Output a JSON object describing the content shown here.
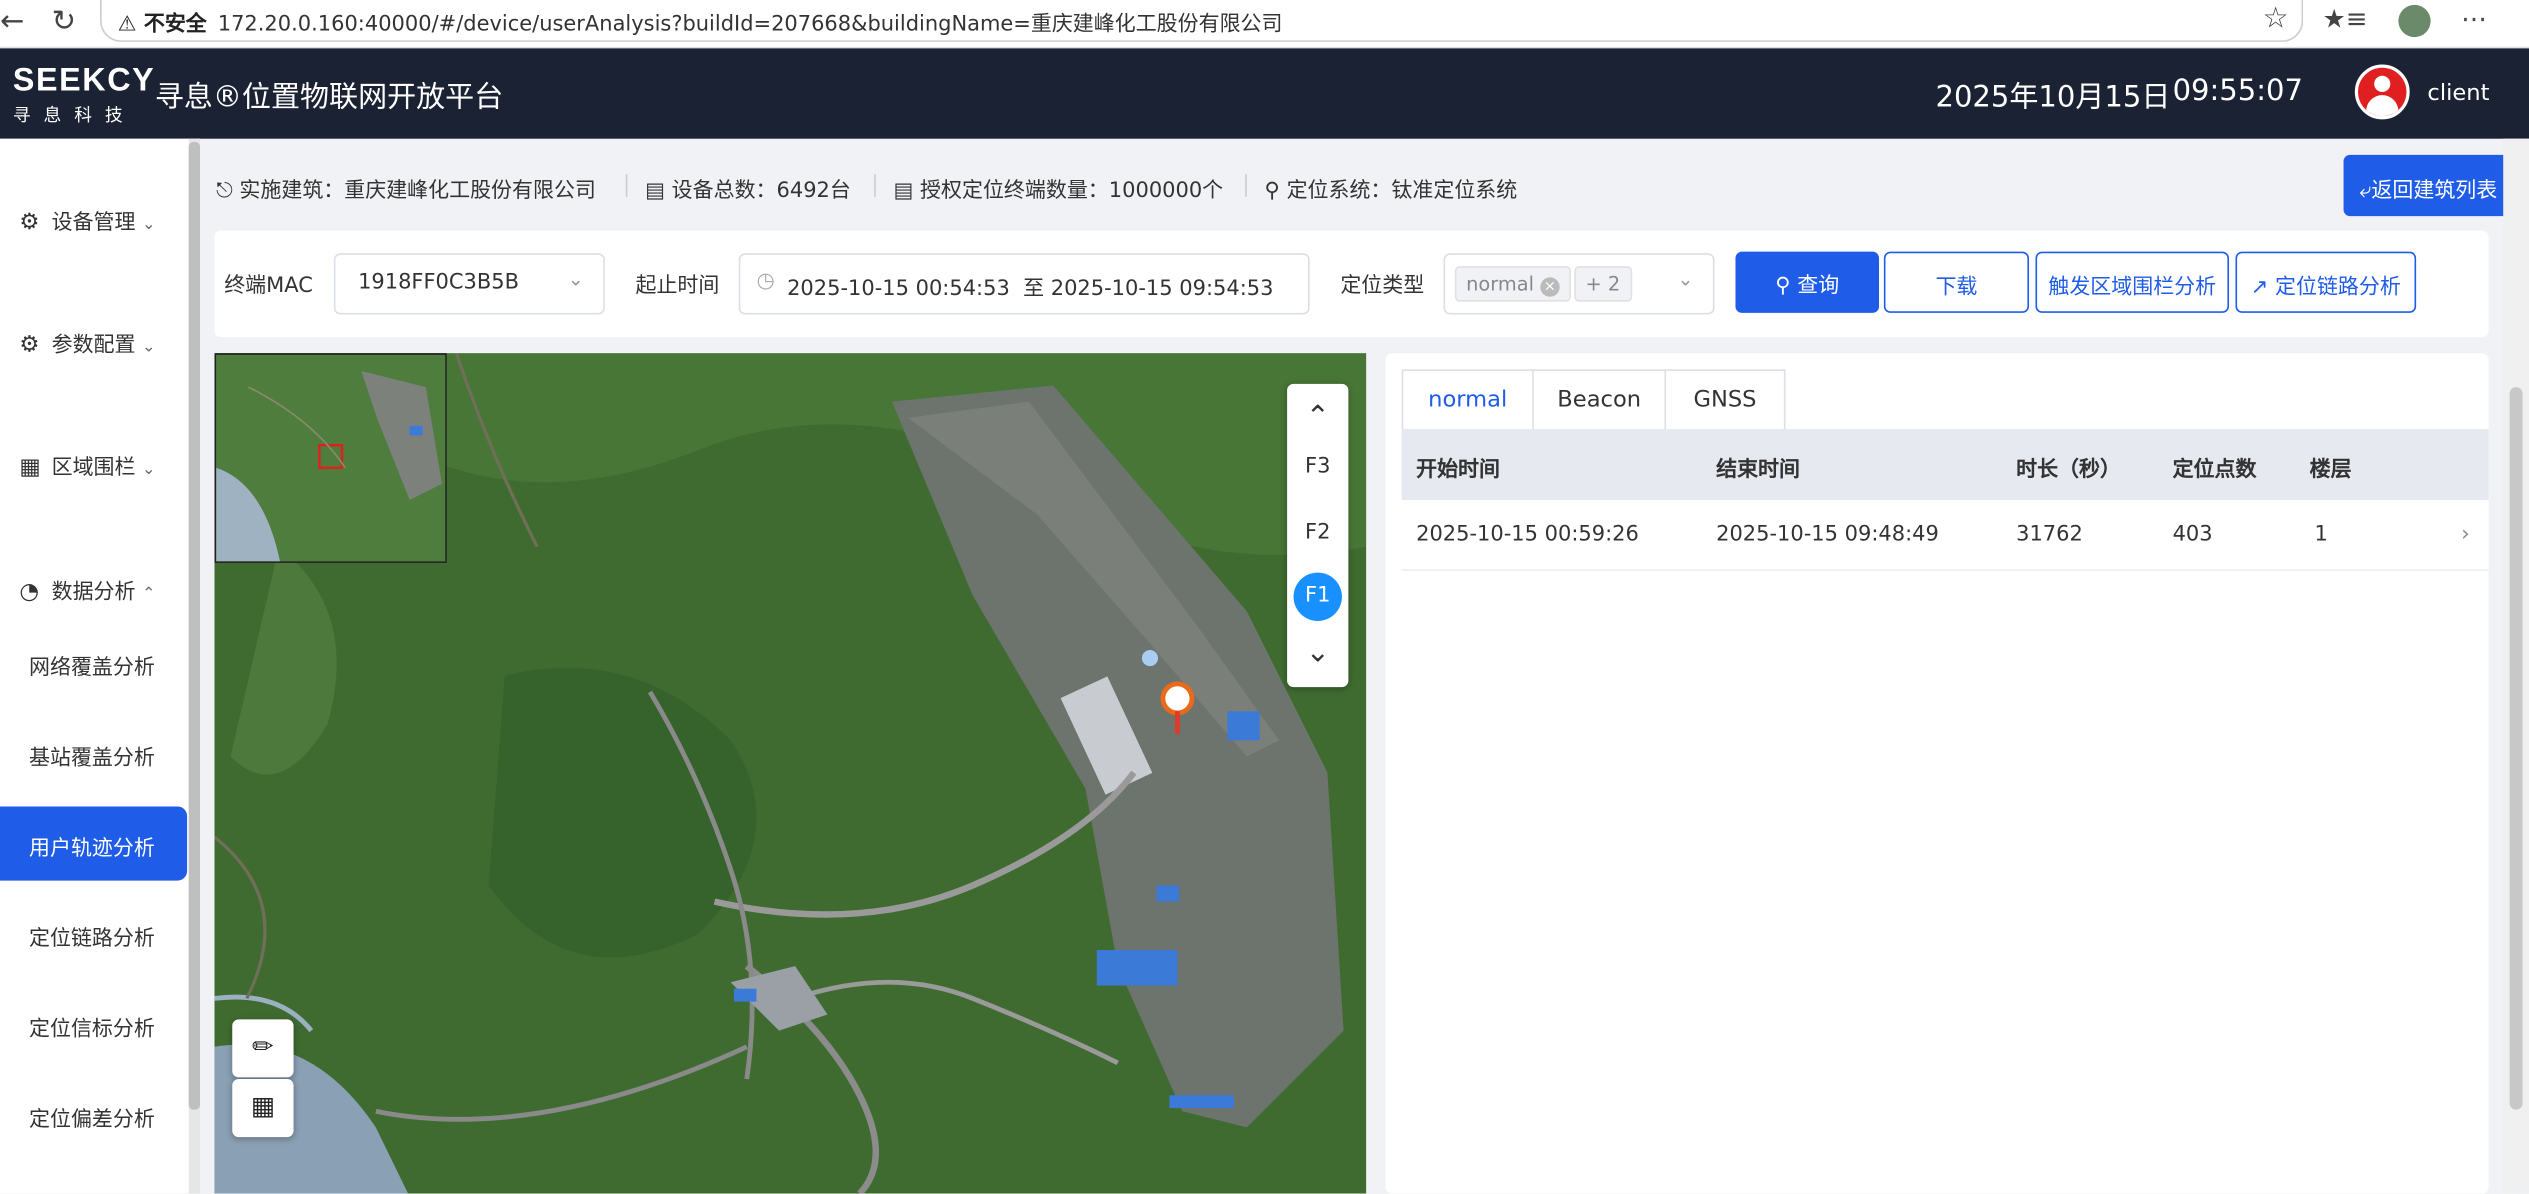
{
  "browser": {
    "security_label": "不安全",
    "url": "172.20.0.160:40000/#/device/userAnalysis?buildId=207668&buildingName=重庆建峰化工股份有限公司"
  },
  "header": {
    "logo_text": "SEEKCY",
    "logo_sub": "寻息科技",
    "title": "寻息®位置物联网开放平台",
    "date": "2025年10月15日",
    "time": "09:55:07",
    "user": "client"
  },
  "sidebar": {
    "menus": [
      {
        "label": "设备管理",
        "icon": "gear-icon"
      },
      {
        "label": "参数配置",
        "icon": "settings-icon"
      },
      {
        "label": "区域围栏",
        "icon": "fence-icon"
      },
      {
        "label": "数据分析",
        "icon": "pie-icon"
      }
    ],
    "subs": [
      "网络覆盖分析",
      "基站覆盖分析",
      "用户轨迹分析",
      "定位链路分析",
      "定位信标分析",
      "定位偏差分析"
    ]
  },
  "info": {
    "building_label": "实施建筑：",
    "building": "重庆建峰化工股份有限公司",
    "devices_label": "设备总数：",
    "devices": "6492台",
    "terminals_label": "授权定位终端数量：",
    "terminals": "1000000个",
    "system_label": "定位系统：",
    "system": "钛准定位系统",
    "back_button": "返回建筑列表"
  },
  "filter": {
    "mac_label": "终端MAC",
    "mac_value": "1918FF0C3B5B",
    "time_label": "起止时间",
    "time_value": "2025-10-15 00:54:53  至 2025-10-15 09:54:53",
    "type_label": "定位类型",
    "type_tag": "normal",
    "type_more": "+ 2",
    "query_button": "查询",
    "download_button": "下载",
    "fence_button": "触发区域围栏分析",
    "link_button": "定位链路分析"
  },
  "map": {
    "floors": [
      "F3",
      "F2",
      "F1"
    ],
    "active_floor": "F1"
  },
  "tabs": [
    "normal",
    "Beacon",
    "GNSS"
  ],
  "table": {
    "headers": [
      "开始时间",
      "结束时间",
      "时长（秒）",
      "定位点数",
      "楼层"
    ],
    "rows": [
      [
        "2025-10-15 00:59:26",
        "2025-10-15 09:48:49",
        "31762",
        "403",
        "1"
      ]
    ]
  },
  "colors": {
    "primary": "#1f5ce8",
    "header_bg": "#1b2233",
    "floor_active": "#1890ff"
  }
}
